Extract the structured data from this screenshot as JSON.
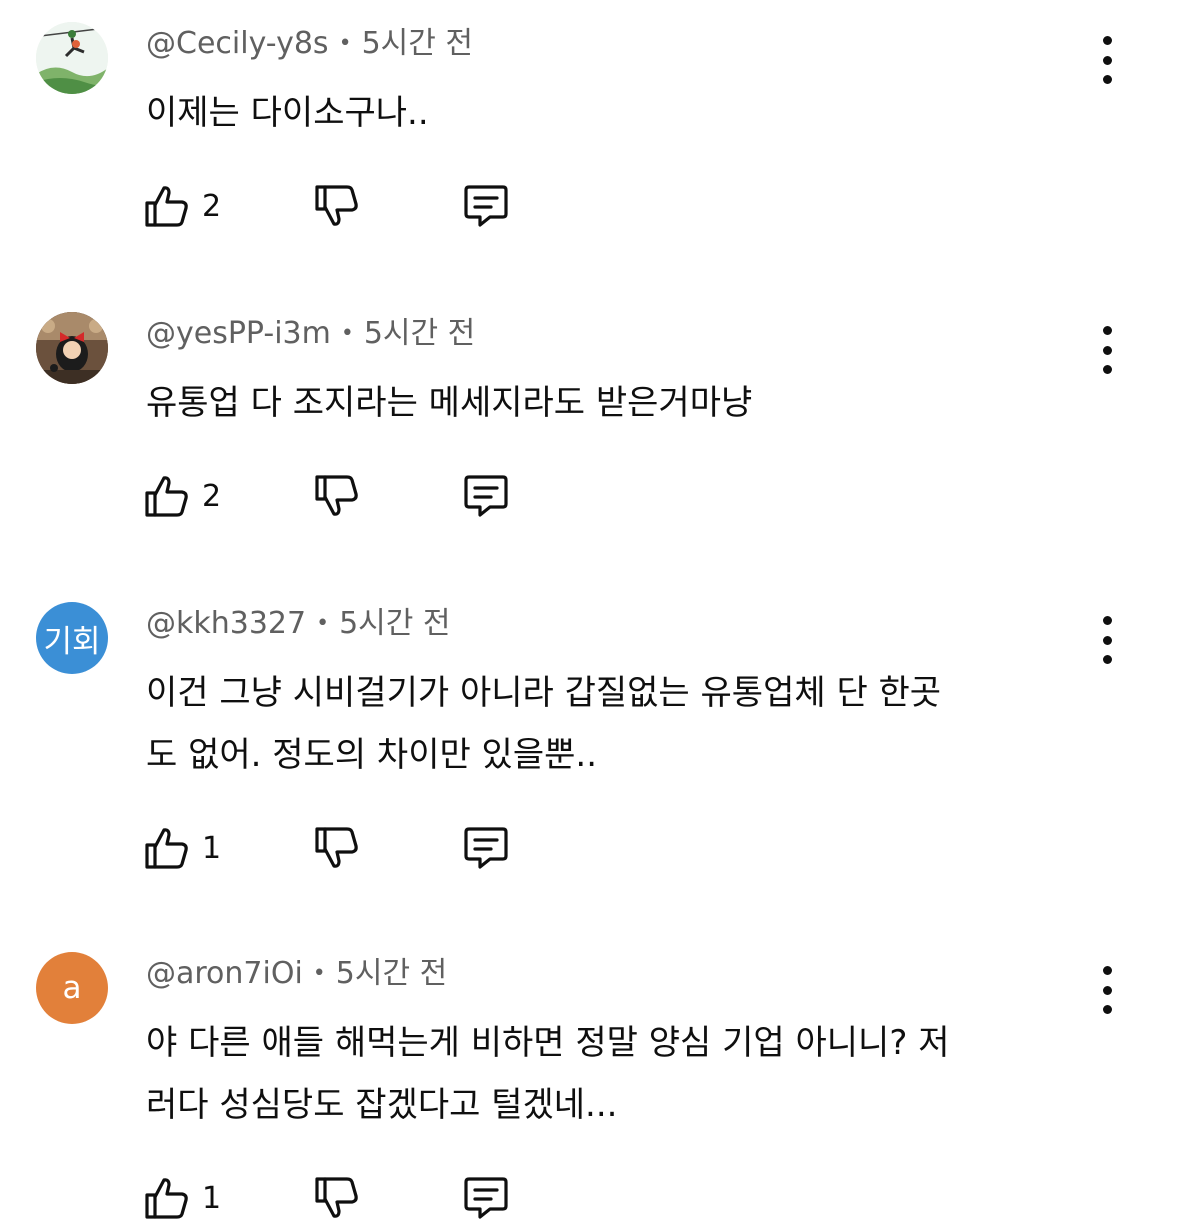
{
  "comments": [
    {
      "author": "@Cecily-y8s",
      "separator": "•",
      "time": "5시간 전",
      "lines": [
        "이제는 다이소구나.."
      ],
      "like_count": "2",
      "avatar": {
        "type": "image",
        "description": "zipline-illustration-avatar"
      }
    },
    {
      "author": "@yesPP-i3m",
      "separator": "•",
      "time": "5시간 전",
      "lines": [
        "유통업 다 조지라는 메세지라도 받은거마냥"
      ],
      "like_count": "2",
      "avatar": {
        "type": "image",
        "description": "witch-with-red-bow-avatar"
      }
    },
    {
      "author": "@kkh3327",
      "separator": "•",
      "time": "5시간 전",
      "lines": [
        "이건 그냥 시비걸기가 아니라 갑질없는 유통업체 단 한곳",
        "도 없어. 정도의 차이만 있을뿐.."
      ],
      "like_count": "1",
      "avatar": {
        "type": "text",
        "text": "기회",
        "color": "#3b8fd6"
      }
    },
    {
      "author": "@aron7iOi",
      "separator": "•",
      "time": "5시간 전",
      "lines": [
        "야 다른 애들 해먹는게 비하면 정말 양심 기업 아니니? 저",
        "러다 성심당도 잡겠다고 털겠네..."
      ],
      "like_count": "1",
      "avatar": {
        "type": "text",
        "text": "a",
        "color": "#e2803a"
      }
    }
  ],
  "icons": {
    "like": "thumb-up-icon",
    "dislike": "thumb-down-icon",
    "reply": "reply-bubble-icon",
    "more": "more-vertical-icon"
  },
  "colors": {
    "text": "#0f0f0f",
    "meta": "#606060",
    "background": "#ffffff"
  }
}
